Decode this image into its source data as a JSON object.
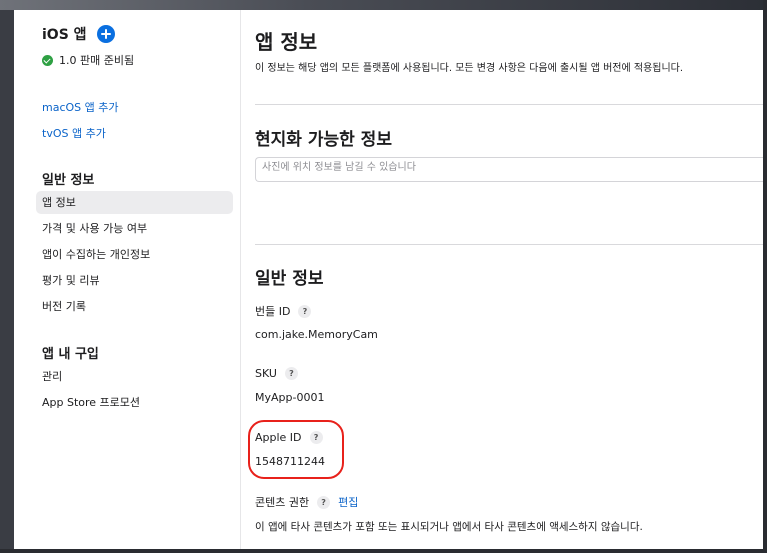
{
  "sidebar": {
    "app_title": "iOS 앱",
    "status": "1.0 판매 준비됨",
    "links": [
      "macOS 앱 추가",
      "tvOS 앱 추가"
    ],
    "general_heading": "일반 정보",
    "general_items": [
      "앱 정보",
      "가격 및 사용 가능 여부",
      "앱이 수집하는 개인정보",
      "평가 및 리뷰",
      "버전 기록"
    ],
    "iap_heading": "앱 내 구입",
    "iap_items": [
      "관리",
      "App Store 프로모션"
    ]
  },
  "main": {
    "title": "앱 정보",
    "description": "이 정보는 해당 앱의 모든 플랫폼에 사용됩니다. 모든 변경 사항은 다음에 출시될 앱 버전에 적용됩니다.",
    "localizable_title": "현지화 가능한 정보",
    "localizable_field_value": "사진에 위치 정보를 남길 수 있습니다",
    "general_title": "일반 정보",
    "bundle_id_label": "번들 ID",
    "bundle_id_value": "com.jake.MemoryCam",
    "sku_label": "SKU",
    "sku_value": "MyApp-0001",
    "apple_id_label": "Apple ID",
    "apple_id_value": "1548711244",
    "content_rights_label": "콘텐츠 권한",
    "content_rights_edit": "편집",
    "content_rights_value": "이 앱에 타사 콘텐츠가 포함 또는 표시되거나 앱에서 타사 콘텐츠에 액세스하지 않습니다.",
    "help_glyph": "?"
  },
  "colors": {
    "accent": "#0a63c9",
    "status_green": "#2ea043",
    "highlight_red": "#e8211b"
  },
  "icons": [
    "plus-circle-icon",
    "checkmark-circle-icon",
    "help-icon"
  ]
}
